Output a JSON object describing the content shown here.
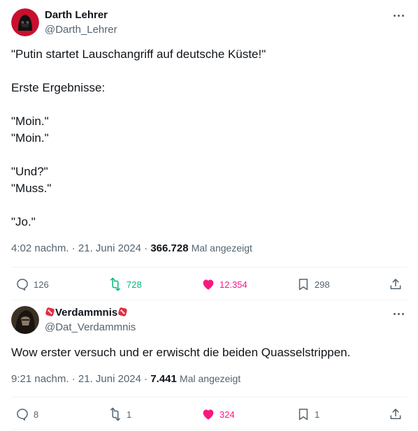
{
  "post1": {
    "display_name": "Darth Lehrer",
    "handle": "@Darth_Lehrer",
    "lines": [
      "\"Putin startet Lauschangriff auf deutsche Küste!\"",
      "",
      "Erste Ergebnisse:",
      "",
      "\"Moin.\"",
      "\"Moin.\"",
      "",
      "\"Und?\"",
      "\"Muss.\"",
      "",
      "\"Jo.\""
    ],
    "time": "4:02 nachm.",
    "separator": "·",
    "date": "21. Juni 2024",
    "views": "366.728",
    "views_label": "Mal angezeigt",
    "replies": "126",
    "reposts": "728",
    "likes": "12.354",
    "bookmarks": "298",
    "colors": {
      "repost_active": "#00ba7c",
      "like_active": "#f91880"
    }
  },
  "post2": {
    "display_name": "Verdammnis",
    "name_emoji": "red-die-emoji",
    "handle": "@Dat_Verdammnis",
    "text": "Wow erster versuch und er erwischt die beiden Quasselstrippen.",
    "time": "9:21 nachm.",
    "separator": "·",
    "date": "21. Juni 2024",
    "views": "7.441",
    "views_label": "Mal angezeigt",
    "replies": "8",
    "reposts": "1",
    "likes": "324",
    "bookmarks": "1",
    "colors": {
      "like_active": "#f91880"
    }
  }
}
